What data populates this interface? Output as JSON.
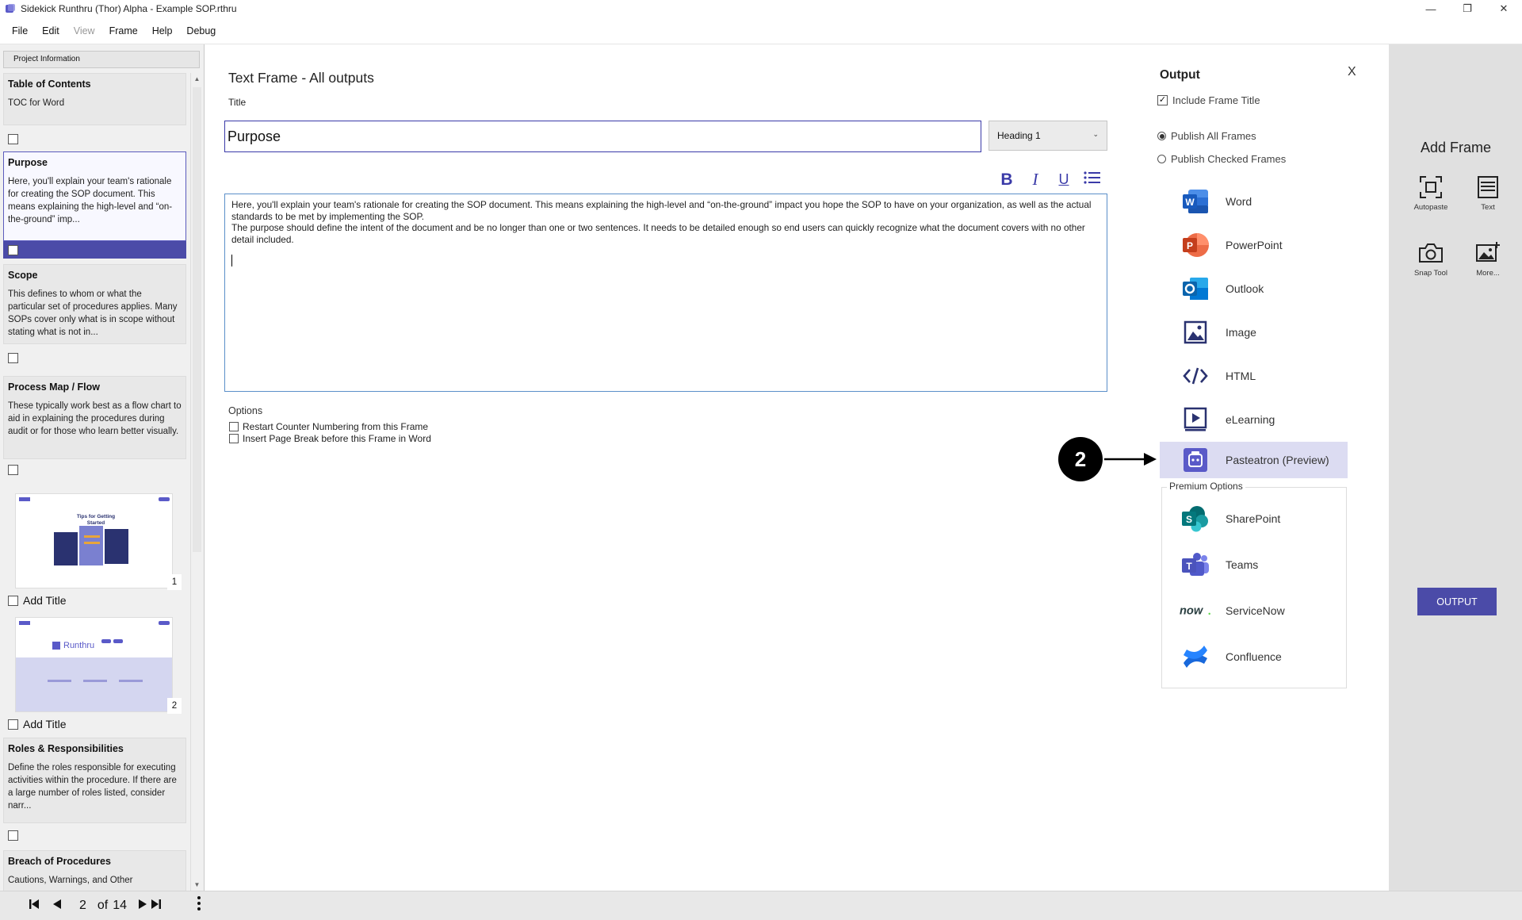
{
  "window": {
    "title": "Sidekick Runthru (Thor) Alpha - Example SOP.rthru",
    "minimize": "—",
    "maximize": "❐",
    "close": "✕"
  },
  "menu": [
    "File",
    "Edit",
    "View",
    "Frame",
    "Help",
    "Debug"
  ],
  "left": {
    "project_info": "Project Information",
    "frames": [
      {
        "title": "Table of Contents",
        "desc": "TOC for Word"
      },
      {
        "title": "Purpose",
        "desc": "Here, you'll explain your team's rationale for creating the SOP document. This means explaining the high-level and “on-the-ground” imp..."
      },
      {
        "title": "Scope",
        "desc": "This defines to whom or what the particular set of procedures applies. Many SOPs cover only what is in scope without stating what is not in..."
      },
      {
        "title": "Process Map / Flow",
        "desc": "These typically work best as a flow chart to aid in explaining the procedures during audit or for those who learn better visually."
      },
      {
        "title": "Roles & Responsibilities",
        "desc": "Define the roles responsible for executing activities within the procedure. If there are a large number of roles listed, consider narr..."
      },
      {
        "title": "Breach of Procedures",
        "desc": "Cautions, Warnings, and Other"
      }
    ],
    "thumbs": [
      {
        "number": "1",
        "add_title": "Add Title",
        "heading": "Tips for Getting Started"
      },
      {
        "number": "2",
        "add_title": "Add Title",
        "heading": "Runthru"
      }
    ]
  },
  "nav": {
    "current": "2",
    "of": "of",
    "total": "14"
  },
  "editor": {
    "heading": "Text Frame - All outputs",
    "title_label": "Title",
    "title_value": "Purpose",
    "heading_style": "Heading 1",
    "body_p1": "Here, you'll explain your team's rationale for creating the SOP document. This means explaining the high-level and “on-the-ground” impact you hope the SOP to have on your organization, as well as the actual standards to be met by implementing the SOP.",
    "body_p2": "The purpose should define the intent of the document and be no longer than one or two sentences. It needs to be detailed enough so end users can quickly recognize what the document covers with no other detail included.",
    "options_label": "Options",
    "opt1": "Restart Counter Numbering from this Frame",
    "opt2": "Insert Page Break before this Frame in Word"
  },
  "output": {
    "title": "Output",
    "close": "X",
    "include_title": "Include Frame Title",
    "include_title_checked": true,
    "publish_all": "Publish All Frames",
    "publish_checked": "Publish Checked Frames",
    "publish_mode": "all",
    "items": [
      "Word",
      "PowerPoint",
      "Outlook",
      "Image",
      "HTML",
      "eLearning",
      "Pasteatron (Preview)"
    ],
    "premium_label": "Premium Options",
    "premium": [
      "SharePoint",
      "Teams",
      "ServiceNow",
      "Confluence"
    ],
    "callout": "2"
  },
  "right": {
    "title": "Add Frame",
    "tools": [
      "Autopaste",
      "Text",
      "Snap Tool",
      "More..."
    ],
    "output_button": "OUTPUT"
  },
  "colors": {
    "accent": "#4b4ba8",
    "selected_bg": "#dcdcf2"
  }
}
